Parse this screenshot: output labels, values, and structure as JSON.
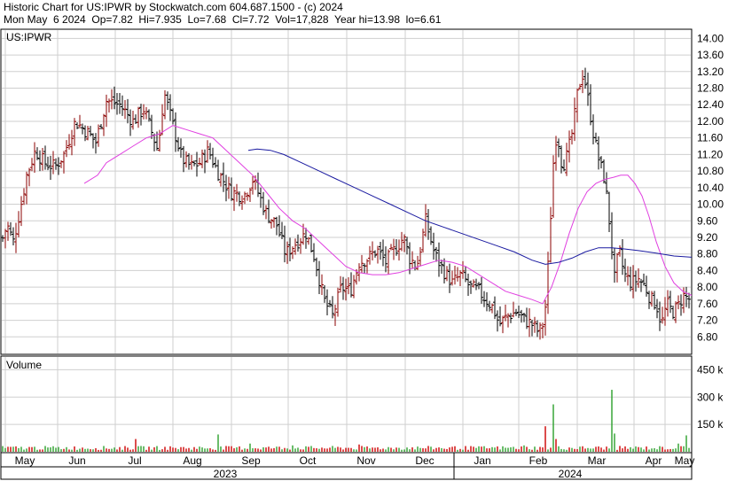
{
  "header": {
    "line1": "Historic Chart for US:IPWR by Stockwatch.com 604.687.1500 - (c) 2024",
    "line2": "Mon May  6 2024  Op=7.82  Hi=7.935  Lo=7.68  Cl=7.72  Vol=17,828  Year hi=13.98  lo=6.61"
  },
  "colors": {
    "up": "#8b0000",
    "down": "#000000",
    "ma_short": "#e040e0",
    "ma_long": "#1a1aa0",
    "vol_up": "#2aa02a",
    "vol_down": "#cc0000"
  },
  "chart_data": [
    {
      "type": "ohlc",
      "label": "US:IPWR",
      "yticks": [
        6.8,
        7.2,
        7.6,
        8.0,
        8.4,
        8.8,
        9.2,
        9.6,
        10.0,
        10.4,
        10.8,
        11.2,
        11.6,
        12.0,
        12.4,
        12.8,
        13.2,
        13.6,
        14.0
      ],
      "ylim": [
        6.4,
        14.2
      ],
      "grid": true,
      "price_anchors": [
        [
          0,
          9.0
        ],
        [
          8,
          9.5
        ],
        [
          15,
          9.1
        ],
        [
          22,
          9.8
        ],
        [
          30,
          10.7
        ],
        [
          40,
          11.3
        ],
        [
          50,
          11.0
        ],
        [
          62,
          10.9
        ],
        [
          72,
          11.2
        ],
        [
          85,
          12.0
        ],
        [
          100,
          11.7
        ],
        [
          108,
          11.5
        ],
        [
          120,
          12.5
        ],
        [
          135,
          12.4
        ],
        [
          150,
          12.0
        ],
        [
          162,
          12.3
        ],
        [
          170,
          11.8
        ],
        [
          178,
          11.3
        ],
        [
          185,
          12.7
        ],
        [
          195,
          11.9
        ],
        [
          205,
          11.1
        ],
        [
          215,
          10.9
        ],
        [
          225,
          11.0
        ],
        [
          235,
          11.3
        ],
        [
          245,
          10.8
        ],
        [
          260,
          10.3
        ],
        [
          275,
          10.2
        ],
        [
          285,
          10.6
        ],
        [
          300,
          9.8
        ],
        [
          312,
          9.5
        ],
        [
          322,
          8.8
        ],
        [
          335,
          9.1
        ],
        [
          345,
          9.3
        ],
        [
          355,
          8.7
        ],
        [
          365,
          7.7
        ],
        [
          375,
          7.3
        ],
        [
          385,
          8.0
        ],
        [
          395,
          7.9
        ],
        [
          405,
          8.6
        ],
        [
          415,
          8.7
        ],
        [
          425,
          8.9
        ],
        [
          435,
          8.6
        ],
        [
          445,
          8.9
        ],
        [
          455,
          9.2
        ],
        [
          462,
          8.7
        ],
        [
          470,
          8.5
        ],
        [
          480,
          9.6
        ],
        [
          490,
          8.8
        ],
        [
          500,
          8.4
        ],
        [
          510,
          8.1
        ],
        [
          520,
          8.3
        ],
        [
          530,
          8.0
        ],
        [
          540,
          7.9
        ],
        [
          548,
          7.7
        ],
        [
          556,
          7.5
        ],
        [
          563,
          7.1
        ],
        [
          572,
          7.3
        ],
        [
          582,
          7.4
        ],
        [
          592,
          7.2
        ],
        [
          600,
          7.1
        ],
        [
          608,
          6.9
        ],
        [
          614,
          7.2
        ],
        [
          618,
          8.5
        ],
        [
          624,
          11.0
        ],
        [
          628,
          11.8
        ],
        [
          634,
          10.9
        ],
        [
          640,
          11.2
        ],
        [
          646,
          11.8
        ],
        [
          652,
          12.8
        ],
        [
          658,
          13.2
        ],
        [
          664,
          12.4
        ],
        [
          670,
          11.6
        ],
        [
          676,
          11.0
        ],
        [
          682,
          10.6
        ],
        [
          688,
          9.4
        ],
        [
          693,
          8.2
        ],
        [
          698,
          8.9
        ],
        [
          704,
          8.3
        ],
        [
          712,
          8.1
        ],
        [
          720,
          8.2
        ],
        [
          728,
          8.0
        ],
        [
          734,
          7.7
        ],
        [
          740,
          7.6
        ],
        [
          746,
          7.1
        ],
        [
          752,
          7.6
        ],
        [
          758,
          7.4
        ],
        [
          764,
          7.5
        ],
        [
          770,
          7.8
        ],
        [
          778,
          7.7
        ]
      ],
      "ma_short": [
        [
          95,
          10.5
        ],
        [
          110,
          10.7
        ],
        [
          120,
          11.0
        ],
        [
          135,
          11.2
        ],
        [
          150,
          11.4
        ],
        [
          165,
          11.6
        ],
        [
          180,
          11.7
        ],
        [
          195,
          11.9
        ],
        [
          210,
          11.8
        ],
        [
          225,
          11.7
        ],
        [
          240,
          11.6
        ],
        [
          255,
          11.3
        ],
        [
          270,
          11.0
        ],
        [
          285,
          10.7
        ],
        [
          300,
          10.3
        ],
        [
          315,
          9.9
        ],
        [
          330,
          9.6
        ],
        [
          345,
          9.4
        ],
        [
          360,
          9.1
        ],
        [
          375,
          8.8
        ],
        [
          390,
          8.5
        ],
        [
          405,
          8.35
        ],
        [
          420,
          8.3
        ],
        [
          435,
          8.3
        ],
        [
          450,
          8.35
        ],
        [
          465,
          8.45
        ],
        [
          480,
          8.55
        ],
        [
          495,
          8.65
        ],
        [
          510,
          8.6
        ],
        [
          525,
          8.5
        ],
        [
          540,
          8.3
        ],
        [
          555,
          8.1
        ],
        [
          570,
          7.9
        ],
        [
          585,
          7.8
        ],
        [
          600,
          7.7
        ],
        [
          612,
          7.6
        ],
        [
          622,
          8.0
        ],
        [
          632,
          8.6
        ],
        [
          642,
          9.3
        ],
        [
          652,
          9.9
        ],
        [
          662,
          10.3
        ],
        [
          672,
          10.5
        ],
        [
          682,
          10.6
        ],
        [
          692,
          10.65
        ],
        [
          700,
          10.7
        ],
        [
          708,
          10.7
        ],
        [
          716,
          10.5
        ],
        [
          724,
          10.2
        ],
        [
          732,
          9.7
        ],
        [
          740,
          9.1
        ],
        [
          750,
          8.5
        ],
        [
          760,
          8.1
        ],
        [
          770,
          7.9
        ],
        [
          780,
          7.8
        ]
      ],
      "ma_long": [
        [
          280,
          11.3
        ],
        [
          290,
          11.33
        ],
        [
          305,
          11.3
        ],
        [
          320,
          11.2
        ],
        [
          340,
          11.0
        ],
        [
          360,
          10.8
        ],
        [
          380,
          10.6
        ],
        [
          400,
          10.4
        ],
        [
          420,
          10.2
        ],
        [
          440,
          10.0
        ],
        [
          460,
          9.8
        ],
        [
          480,
          9.6
        ],
        [
          500,
          9.45
        ],
        [
          520,
          9.3
        ],
        [
          540,
          9.15
        ],
        [
          560,
          9.0
        ],
        [
          580,
          8.85
        ],
        [
          600,
          8.65
        ],
        [
          615,
          8.55
        ],
        [
          630,
          8.6
        ],
        [
          645,
          8.7
        ],
        [
          660,
          8.85
        ],
        [
          675,
          8.95
        ],
        [
          690,
          8.95
        ],
        [
          705,
          8.92
        ],
        [
          720,
          8.88
        ],
        [
          740,
          8.82
        ],
        [
          760,
          8.75
        ],
        [
          780,
          8.72
        ]
      ]
    },
    {
      "type": "bar",
      "label": "Volume",
      "yticks": [
        "150 k",
        "300 k",
        "450 k"
      ],
      "ytick_values": [
        150,
        300,
        450
      ],
      "ylim": [
        0,
        520
      ],
      "spikes": [
        [
          152,
          70
        ],
        [
          245,
          95
        ],
        [
          282,
          45
        ],
        [
          330,
          35
        ],
        [
          404,
          40
        ],
        [
          540,
          30
        ],
        [
          590,
          35
        ],
        [
          616,
          140
        ],
        [
          623,
          260
        ],
        [
          628,
          70
        ],
        [
          690,
          340
        ],
        [
          694,
          100
        ],
        [
          766,
          45
        ],
        [
          773,
          90
        ]
      ]
    }
  ],
  "xaxis": {
    "months": [
      {
        "label": "May",
        "x": 28
      },
      {
        "label": "Jun",
        "x": 87
      },
      {
        "label": "Jul",
        "x": 152
      },
      {
        "label": "Aug",
        "x": 217
      },
      {
        "label": "Sep",
        "x": 283
      },
      {
        "label": "Oct",
        "x": 347
      },
      {
        "label": "Nov",
        "x": 413
      },
      {
        "label": "Dec",
        "x": 479
      },
      {
        "label": "Jan",
        "x": 544
      },
      {
        "label": "Feb",
        "x": 607
      },
      {
        "label": "Mar",
        "x": 673
      },
      {
        "label": "Apr",
        "x": 737
      },
      {
        "label": "May",
        "x": 772
      }
    ],
    "years": [
      {
        "label": "2023",
        "x": 254
      },
      {
        "label": "2024",
        "x": 643
      }
    ]
  }
}
